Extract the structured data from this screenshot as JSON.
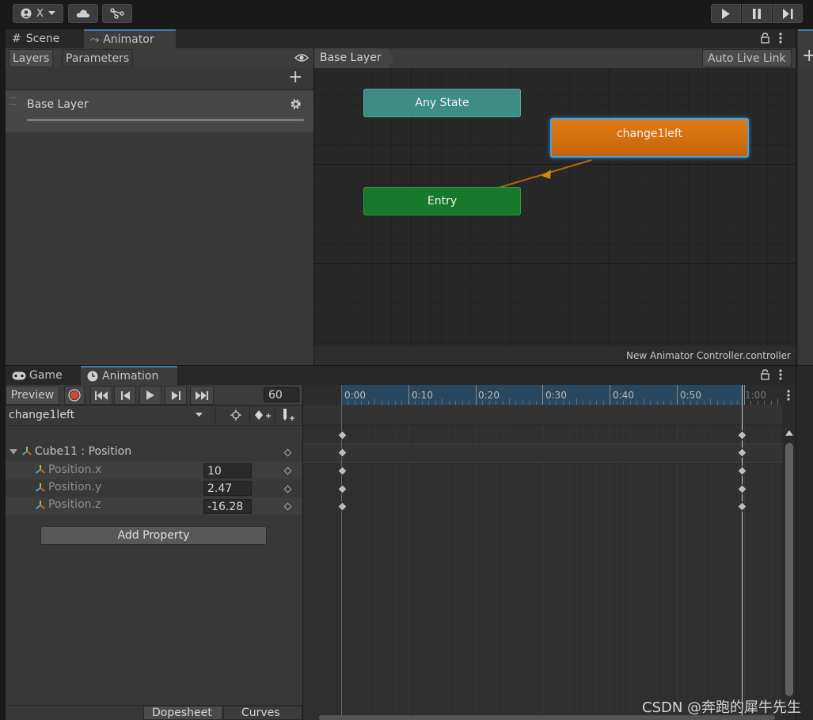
{
  "toolbar": {
    "account_label": "X",
    "account_icon": "account-icon",
    "cloud_icon": "cloud-icon",
    "collab_icon": "collab-icon",
    "play_icon": "play-icon",
    "pause_icon": "pause-icon",
    "step_icon": "step-icon"
  },
  "animator_panel": {
    "tabs": [
      {
        "label": "Scene",
        "icon": "#"
      },
      {
        "label": "Animator",
        "icon": "⤳"
      }
    ],
    "sub_tabs": [
      "Layers",
      "Parameters"
    ],
    "breadcrumb": "Base Layer",
    "auto_live_link": "Auto Live Link",
    "layer_name": "Base Layer",
    "add_label": "+",
    "states": {
      "any_state": "Any State",
      "entry": "Entry",
      "default_state": "change1left"
    },
    "footer_file": "New Animator Controller.controller"
  },
  "animation_panel": {
    "tabs": [
      {
        "label": "Game",
        "icon": "gamepad-icon"
      },
      {
        "label": "Animation",
        "icon": "clock-icon"
      }
    ],
    "preview_label": "Preview",
    "samples": "60",
    "clip_name": "change1left",
    "ruler_labels": [
      "0:00",
      "0:10",
      "0:20",
      "0:30",
      "0:40",
      "0:50",
      "1:00"
    ],
    "property_group": "Cube11 : Position",
    "properties": [
      {
        "name": "Position.x",
        "value": "10"
      },
      {
        "name": "Position.y",
        "value": "2.47"
      },
      {
        "name": "Position.z",
        "value": "-16.28"
      }
    ],
    "add_property": "Add Property",
    "view_tabs": [
      "Dopesheet",
      "Curves"
    ]
  },
  "watermark": "CSDN @奔跑的犀牛先生",
  "colors": {
    "any_state": "#3e8d83",
    "entry": "#16792b",
    "default_state": "#d2700f",
    "accent": "#3a79bb",
    "record": "#e0442b"
  }
}
